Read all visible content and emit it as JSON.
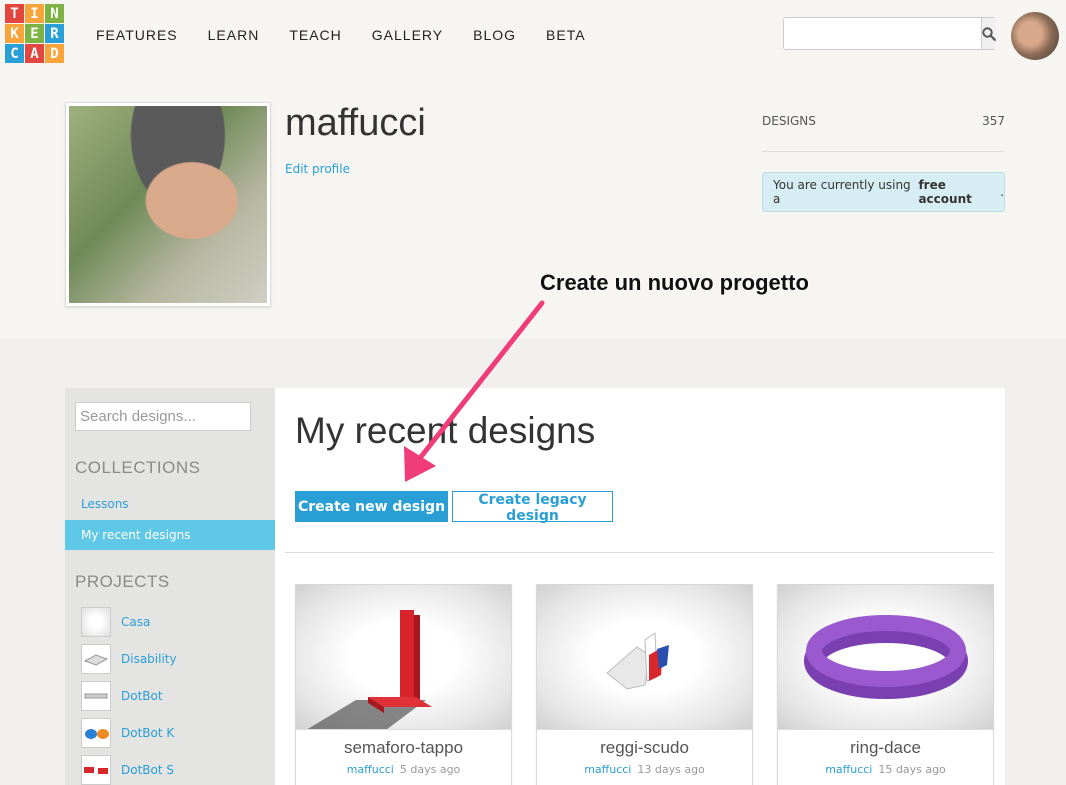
{
  "logo": {
    "letters": [
      "T",
      "I",
      "N",
      "K",
      "E",
      "R",
      "C",
      "A",
      "D"
    ],
    "colors": [
      "#e2463f",
      "#f8a43a",
      "#7cb342",
      "#f8a43a",
      "#7cb342",
      "#2a9fd6",
      "#2a9fd6",
      "#e2463f",
      "#f8a43a"
    ]
  },
  "nav": {
    "items": [
      "FEATURES",
      "LEARN",
      "TEACH",
      "GALLERY",
      "BLOG",
      "BETA"
    ]
  },
  "search": {
    "placeholder": "",
    "icon": "search-icon"
  },
  "profile": {
    "username": "maffucci",
    "edit_link": "Edit profile",
    "stats_label": "DESIGNS",
    "stats_value": "357",
    "account_prefix": "You are currently using a",
    "account_type": "free account",
    "account_suffix": "."
  },
  "annotation": {
    "text": "Create un nuovo progetto",
    "arrow_color": "#f03c78"
  },
  "sidebar": {
    "search_placeholder": "Search designs...",
    "collections_heading": "COLLECTIONS",
    "collections": [
      "Lessons",
      "My recent designs"
    ],
    "active_collection": "My recent designs",
    "projects_heading": "PROJECTS",
    "projects": [
      "Casa",
      "Disability",
      "DotBot",
      "DotBot K",
      "DotBot S"
    ]
  },
  "main": {
    "title": "My recent designs",
    "create_button": "Create new design",
    "legacy_button": "Create legacy design"
  },
  "designs": [
    {
      "title": "semaforo-tappo",
      "owner": "maffucci",
      "time": "5 days ago"
    },
    {
      "title": "reggi-scudo",
      "owner": "maffucci",
      "time": "13 days ago"
    },
    {
      "title": "ring-dace",
      "owner": "maffucci",
      "time": "15 days ago"
    }
  ],
  "colors": {
    "accent": "#2a9fd6",
    "active_bg": "#5fc8e6",
    "notice_bg": "#d6eef3"
  }
}
